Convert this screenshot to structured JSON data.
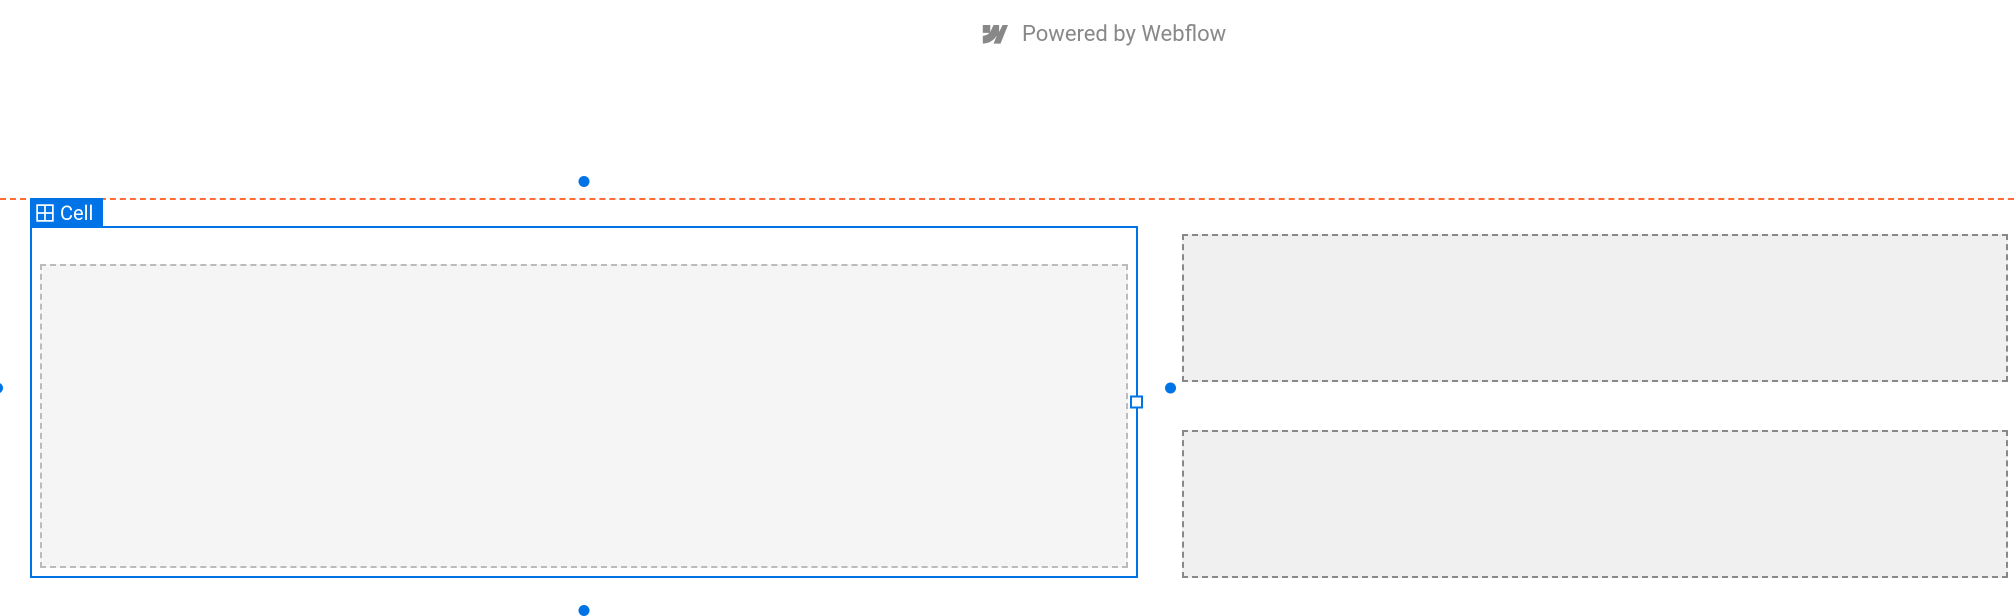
{
  "powered_by": {
    "text": "Powered by Webflow"
  },
  "selection": {
    "element_type": "Cell"
  }
}
